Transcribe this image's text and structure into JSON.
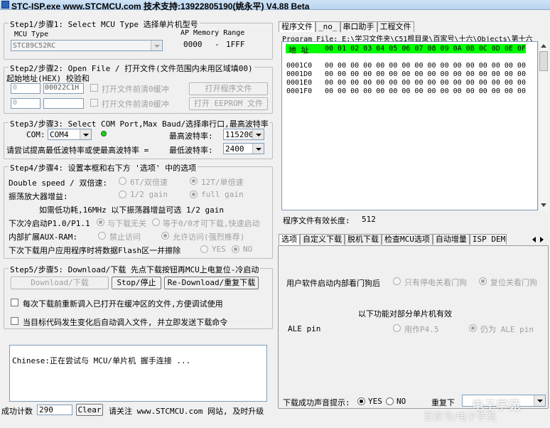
{
  "window": {
    "title": "STC-ISP.exe    www.STCMCU.com  技术支持:13922805190(姚永平)  V4.88 Beta"
  },
  "step1": {
    "legend": "Step1/步骤1: Select MCU Type  选择单片机型号",
    "mcu_type_label": "MCU Type",
    "mcu_type_value": "STC89C52RC",
    "ap_label": "AP Memory Range",
    "ap_start": "0000",
    "ap_dash": "-",
    "ap_end": "1FFF"
  },
  "step2": {
    "legend": "Step2/步骤2: Open File / 打开文件(文件范围内未用区域填00)",
    "addr_label": "起始地址(HEX) 校验和",
    "addr1": "0",
    "checksum1": "00022C1H",
    "check1_label": "打开文件前清0缓冲",
    "open_program_btn": "打开程序文件",
    "addr2": "0",
    "checksum2": "",
    "check2_label": "打开文件前清0缓冲",
    "open_eeprom_btn": "打开 EEPROM 文件"
  },
  "step3": {
    "legend": "Step3/步骤3: Select COM Port,Max Baud/选择串行口,最高波特率",
    "com_label": "COM:",
    "com_value": "COM4",
    "max_baud_label": "最高波特率:",
    "max_baud_value": "115200",
    "hint": "请尝试提高最低波特率或使最高波特率 =",
    "min_baud_label": "最低波特率:",
    "min_baud_value": "2400"
  },
  "step4": {
    "legend": "Step4/步骤4: 设置本框和右下方 '选项' 中的选项",
    "double_speed_label": "Double speed / 双倍速:",
    "opt_6t": "6T/双倍速",
    "opt_12t": "12T/单倍速",
    "osc_gain_label": "振荡放大器增益:",
    "opt_half_gain": "1/2 gain",
    "opt_full_gain": "full gain",
    "gain_note": "如需低功耗,16MHz 以下振荡器增益可选 1/2 gain",
    "cold_start_label": "下次冷启动P1.0/P1.1",
    "opt_no_relation": "与下载无关",
    "opt_equal_zero": "等于0/0才可下载,快速启动",
    "aux_ram_label": "内部扩展AUX-RAM:",
    "opt_forbid": "禁止访问",
    "opt_allow": "允许访问(强烈推荐)",
    "flash_erase_label": "下次下载用户应用程序时将数据Flash区一并擦除",
    "opt_yes": "YES",
    "opt_no": "NO"
  },
  "step5": {
    "legend": "Step5/步骤5: Download/下载  先点下载按钮再MCU上电复位-冷启动",
    "download_btn": "Download/下载",
    "stop_btn": "Stop/停止",
    "redownload_btn": "Re-Download/重复下载",
    "check_reload": "每次下载前重新调入已打开在缓冲区的文件,方便调试使用",
    "check_auto": "当目标代码发生变化后自动调入文件, 并立即发送下载命令"
  },
  "log": {
    "text": "Chinese:正在尝试与  MCU/单片机 握手连接 ..."
  },
  "statusbar": {
    "success_label": "成功计数",
    "success_count": "290",
    "clear_btn": "Clear",
    "notice": "请关注 www.STCMCU.com 网站, 及时升级"
  },
  "right_top": {
    "tabs": [
      "程序文件",
      "_no_",
      "串口助手",
      "工程文件"
    ],
    "program_file_label": "Program File: E:\\学习文件夹\\C51根目录\\百家号\\十六\\Objects\\第十六",
    "hex_header_addr": "地 址",
    "hex_header_cols": "00 01 02 03 04 05 06 07 08 09 0A 0B 0C 0D 0E 0F",
    "hex_rows": [
      {
        "addr": "0001C0",
        "bytes": "00 00 00 00 00 00 00 00 00 00 00 00 00 00 00 00"
      },
      {
        "addr": "0001D0",
        "bytes": "00 00 00 00 00 00 00 00 00 00 00 00 00 00 00 00"
      },
      {
        "addr": "0001E0",
        "bytes": "00 00 00 00 00 00 00 00 00 00 00 00 00 00 00 00"
      },
      {
        "addr": "0001F0",
        "bytes": "00 00 00 00 00 00 00 00 00 00 00 00 00 00 00 00"
      }
    ],
    "valid_length_label": "程序文件有效长度:",
    "valid_length_value": "512"
  },
  "right_bottom": {
    "tabs": [
      "选项",
      "自定义下载",
      "脱机下载",
      "检查MCU选项",
      "自动增量",
      "ISP DEMO"
    ],
    "watchdog_label": "用户软件启动内部看门狗后",
    "opt_power_off_wdt": "只有停电关看门狗",
    "opt_reset_wdt": "复位关看门狗",
    "partial_note": "以下功能对部分单片机有效",
    "ale_label": "ALE pin",
    "opt_p45": "用作P4.5",
    "opt_ale": "仍为 ALE pin",
    "sound_label": "下载成功声音提示:",
    "sound_yes": "YES",
    "sound_no": "NO",
    "repeat_label": "重复下"
  },
  "watermark": {
    "brand": "电子学苑",
    "subtitle": "百家号/电子学苑"
  }
}
